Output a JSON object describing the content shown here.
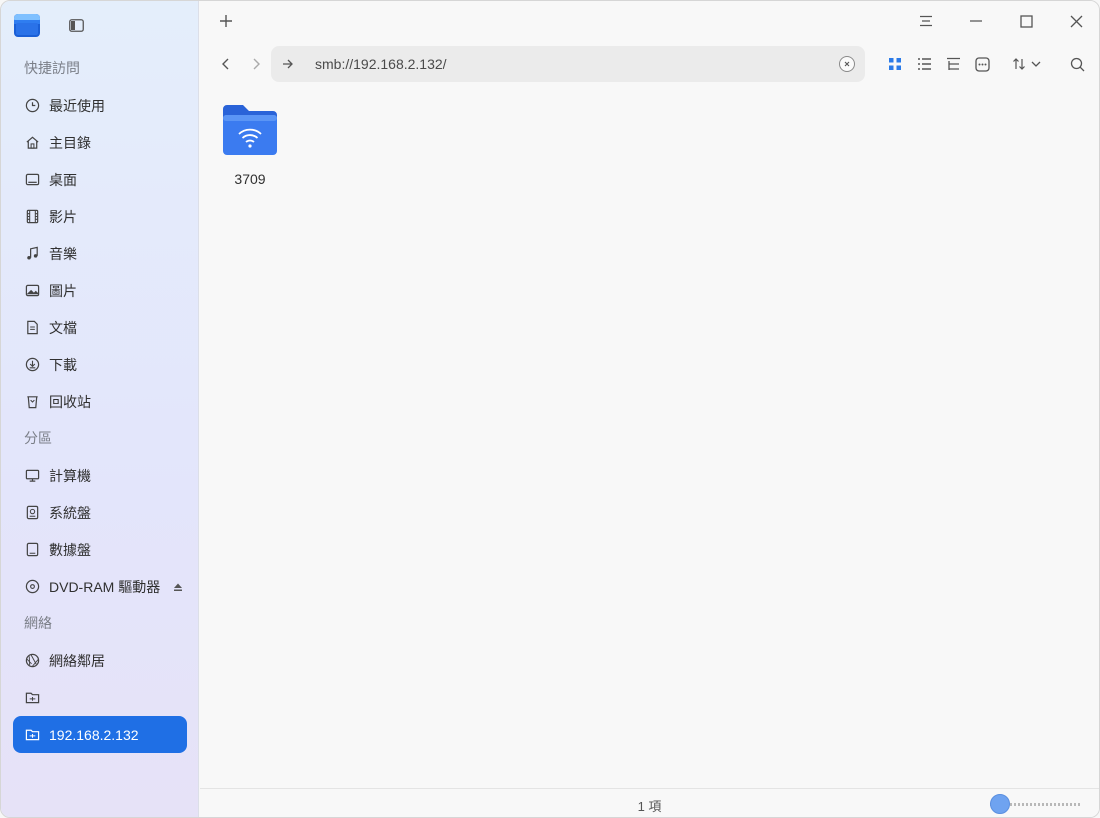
{
  "sidebar": {
    "sections": [
      {
        "title": "快捷訪問",
        "items": [
          {
            "label": "最近使用",
            "icon": "clock-icon"
          },
          {
            "label": "主目錄",
            "icon": "home-icon"
          },
          {
            "label": "桌面",
            "icon": "desktop-icon"
          },
          {
            "label": "影片",
            "icon": "film-icon"
          },
          {
            "label": "音樂",
            "icon": "music-icon"
          },
          {
            "label": "圖片",
            "icon": "picture-icon"
          },
          {
            "label": "文檔",
            "icon": "document-icon"
          },
          {
            "label": "下載",
            "icon": "download-icon"
          },
          {
            "label": "回收站",
            "icon": "trash-icon"
          }
        ]
      },
      {
        "title": "分區",
        "items": [
          {
            "label": "計算機",
            "icon": "computer-icon"
          },
          {
            "label": "系統盤",
            "icon": "system-disk-icon"
          },
          {
            "label": "數據盤",
            "icon": "data-disk-icon"
          },
          {
            "label": "DVD-RAM 驅動器",
            "icon": "optical-drive-icon"
          }
        ]
      },
      {
        "title": "網絡",
        "items": [
          {
            "label": "網絡鄰居",
            "icon": "network-icon"
          },
          {
            "label": "",
            "icon": "smb-share-icon"
          },
          {
            "label": "192.168.2.132",
            "icon": "smb-share-icon",
            "active": true
          }
        ]
      }
    ]
  },
  "address": {
    "url": "smb://192.168.2.132/"
  },
  "files": [
    {
      "name": "3709",
      "icon": "network-folder-icon"
    }
  ],
  "status": {
    "count_text": "1 項"
  },
  "zoom": {
    "level_fraction": 0.0
  },
  "colors": {
    "accent": "#1f6fe5",
    "folder": "#3b7bf0"
  }
}
